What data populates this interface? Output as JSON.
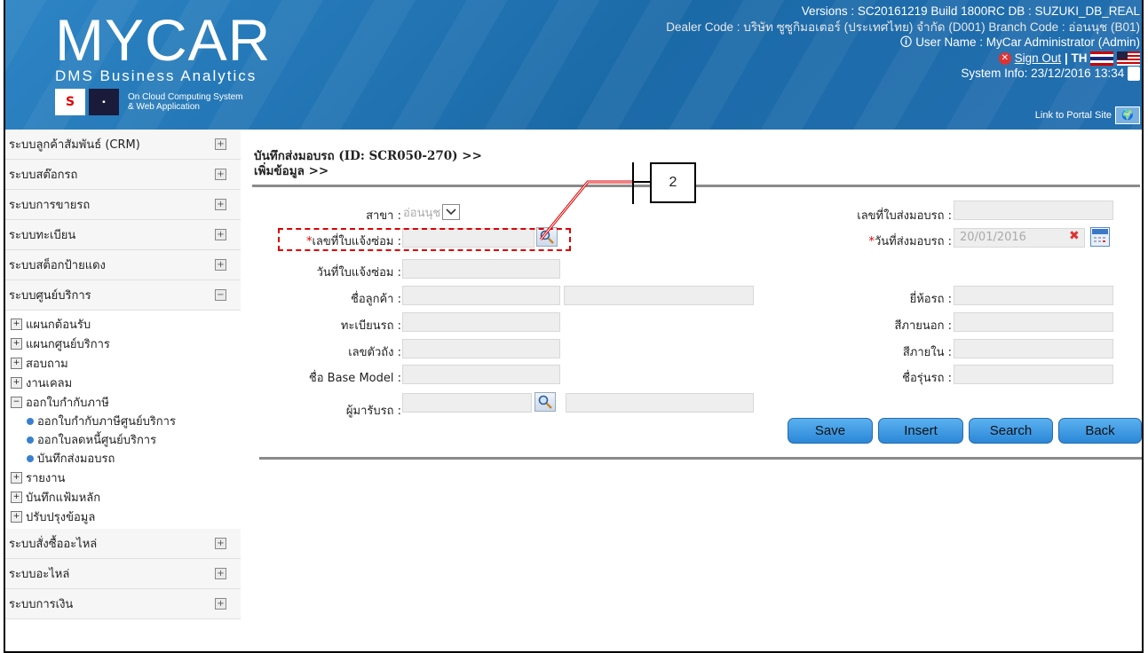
{
  "header": {
    "logo": "MYCAR",
    "logo_sub": "DMS Business Analytics",
    "logo_caption_1": "On Cloud Computing System",
    "logo_caption_2": "& Web Application",
    "versions": "Versions : SC20161219 Build 1800RC DB : SUZUKI_DB_REAL",
    "dealer_code": "Dealer Code : บริษัท ซูซูกิมอเตอร์ (ประเทศไทย) จำกัด (D001)  Branch Code : อ่อนนุช (B01)",
    "user_name": "User Name : MyCar Administrator  (Admin)",
    "sign_out": "Sign Out",
    "lang": "| TH",
    "system_info": "System Info: 23/12/2016 13:34",
    "portal_link": "Link to Portal Site"
  },
  "sidebar": {
    "main_items": [
      {
        "label": "ระบบลูกค้าสัมพันธ์ (CRM)",
        "toggle": "+"
      },
      {
        "label": "ระบบสต๊อกรถ",
        "toggle": "+"
      },
      {
        "label": "ระบบการขายรถ",
        "toggle": "+"
      },
      {
        "label": "ระบบทะเบียน",
        "toggle": "+"
      },
      {
        "label": "ระบบสต็อกป้ายแดง",
        "toggle": "+"
      },
      {
        "label": "ระบบศูนย์บริการ",
        "toggle": "−"
      }
    ],
    "sub_items": [
      {
        "label": "แผนกต้อนรับ"
      },
      {
        "label": "แผนกศูนย์บริการ"
      },
      {
        "label": "สอบถาม"
      },
      {
        "label": "งานเคลม"
      },
      {
        "label": "ออกใบกำกับภาษี"
      }
    ],
    "subsub_items": [
      {
        "label": "ออกใบกำกับภาษีศูนย์บริการ"
      },
      {
        "label": "ออกใบลดหนี้ศูนย์บริการ"
      },
      {
        "label": "บันทึกส่งมอบรถ"
      }
    ],
    "sub_items_2": [
      {
        "label": "รายงาน"
      },
      {
        "label": "บันทึกแฟ้มหลัก"
      },
      {
        "label": "ปรับปรุงข้อมูล"
      }
    ],
    "main_items_2": [
      {
        "label": "ระบบสั่งซื้ออะไหล่",
        "toggle": "+"
      },
      {
        "label": "ระบบอะไหล่",
        "toggle": "+"
      },
      {
        "label": "ระบบการเงิน",
        "toggle": "+"
      }
    ]
  },
  "page": {
    "title_line1": "บันทึกส่งมอบรถ (ID: SCR050-270) >>",
    "title_line2": "เพิ่มข้อมูล >>"
  },
  "form": {
    "branch_label": "สาขา :",
    "branch_value": "อ่อนนุช",
    "repair_no_label": "เลขที่ใบแจ้งซ่อม :",
    "repair_no_required": "*",
    "repair_date_label": "วันที่ใบแจ้งซ่อม :",
    "customer_label": "ชื่อลูกค้า :",
    "plate_label": "ทะเบียนรถ :",
    "chassis_label": "เลขตัวถัง :",
    "base_model_label": "ชื่อ Base Model :",
    "receiver_label": "ผู้มารับรถ :",
    "delivery_no_label": "เลขที่ใบส่งมอบรถ :",
    "delivery_date_label": "วันที่ส่งมอบรถ :",
    "delivery_date_required": "*",
    "delivery_date_value": "20/01/2016",
    "brand_label": "ยี่ห้อรถ :",
    "ext_color_label": "สีภายนอก :",
    "int_color_label": "สีภายใน :",
    "model_name_label": "ชื่อรุ่นรถ :"
  },
  "buttons": {
    "save": "Save",
    "insert": "Insert",
    "search": "Search",
    "back": "Back"
  },
  "annotation": {
    "label": "2"
  },
  "colors": {
    "header_bg": "#1f6fae",
    "button_bg": "#3c98e2",
    "annotation": "#d00000"
  }
}
